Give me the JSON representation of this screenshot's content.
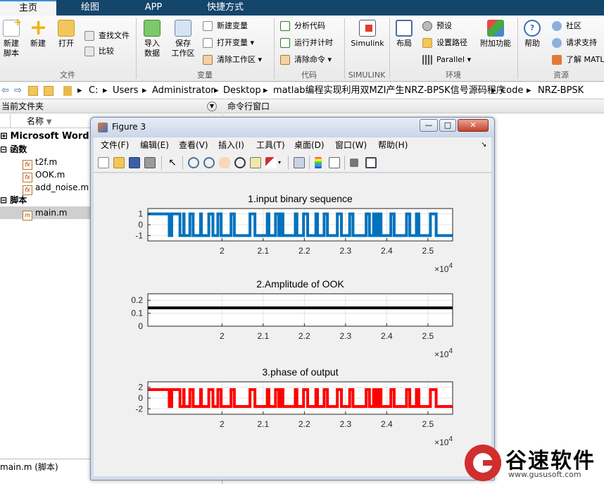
{
  "tabs": [
    "主页",
    "绘图",
    "APP",
    "快捷方式"
  ],
  "ribbon": {
    "big_buttons": [
      {
        "label": "新建\n脚本",
        "icon": "new-script-icon"
      },
      {
        "label": "新建",
        "icon": "new-icon"
      },
      {
        "label": "打开",
        "icon": "open-folder-icon"
      },
      {
        "label": "导入\n数据",
        "icon": "import-data-icon"
      },
      {
        "label": "保存\n工作区",
        "icon": "save-workspace-icon"
      },
      {
        "label": "Simulink",
        "icon": "simulink-icon"
      },
      {
        "label": "布局",
        "icon": "layout-icon"
      },
      {
        "label": "附加功能",
        "icon": "add-ons-icon"
      },
      {
        "label": "帮助",
        "icon": "help-icon"
      }
    ],
    "small_buttons": {
      "find_files": "查找文件",
      "compare": "比较",
      "new_variable": "新建变量",
      "open_variable": "打开变量",
      "clear_workspace": "清除工作区",
      "analyze_code": "分析代码",
      "run_and_time": "运行并计时",
      "clear_commands": "清除命令",
      "preferences": "预设",
      "set_path": "设置路径",
      "parallel": "Parallel",
      "community": "社区",
      "request_support": "请求支持",
      "learn_matlab": "了解 MATL"
    },
    "groups": [
      "文件",
      "变量",
      "代码",
      "SIMULINK",
      "环境",
      "资源"
    ]
  },
  "address": {
    "drive": "C:",
    "path": [
      "Users",
      "Administrator",
      "Desktop",
      "matlab编程实现利用双MZI产生NRZ-BPSK信号源码程序",
      "code",
      "NRZ-BPSK"
    ]
  },
  "current_folder": {
    "title": "当前文件夹",
    "column": "名称",
    "items": [
      {
        "label": "Microsoft Word 文",
        "kind": "group"
      },
      {
        "label": "函数",
        "kind": "group"
      },
      {
        "label": "t2f.m",
        "kind": "file"
      },
      {
        "label": "OOK.m",
        "kind": "file"
      },
      {
        "label": "add_noise.m",
        "kind": "file"
      },
      {
        "label": "脚本",
        "kind": "group"
      },
      {
        "label": "main.m",
        "kind": "file",
        "selected": true
      }
    ],
    "status": "main.m  (脚本)"
  },
  "command_window": {
    "title": "命令行窗口"
  },
  "figure": {
    "title": "Figure 3",
    "menu": [
      "文件(F)",
      "编辑(E)",
      "查看(V)",
      "插入(I)",
      "工具(T)",
      "桌面(D)",
      "窗口(W)",
      "帮助(H)"
    ],
    "window_controls": {
      "minimize": "—",
      "maximize": "□",
      "close": "✕"
    },
    "toolbar_icons": [
      "new-figure-icon",
      "open-icon",
      "save-icon",
      "print-icon",
      "pointer-icon",
      "zoom-in-icon",
      "zoom-out-icon",
      "pan-icon",
      "rotate-icon",
      "data-cursor-icon",
      "brush-icon",
      "link-icon",
      "colorbar-icon",
      "legend-icon",
      "hide-plot-tools-icon",
      "show-plot-tools-icon"
    ]
  },
  "watermark": {
    "text": "谷速软件",
    "url": "www.gususoft.com"
  },
  "chart_data": [
    {
      "type": "line",
      "title": "1.input binary sequence",
      "color": "#0072bd",
      "xlim": [
        1.82,
        2.56
      ],
      "ylim": [
        -1.5,
        1.5
      ],
      "xticks": [
        2,
        2.1,
        2.2,
        2.3,
        2.4,
        2.5
      ],
      "yticks": [
        -1,
        0,
        1
      ],
      "exponent_label": "×10^4",
      "levels": [
        -1,
        1
      ],
      "transitions": [
        1.82,
        1.872,
        1.878,
        1.898,
        1.907,
        1.908,
        1.922,
        1.93,
        1.948,
        1.95,
        1.968,
        1.978,
        1.99,
        1.998,
        2.022,
        2.03,
        2.068,
        2.08,
        2.11,
        2.114,
        2.13,
        2.138,
        2.142,
        2.148,
        2.178,
        2.182,
        2.198,
        2.208,
        2.228,
        2.232,
        2.248,
        2.256,
        2.28,
        2.29,
        2.31,
        2.318,
        2.35,
        2.358,
        2.368,
        2.374,
        2.38,
        2.386,
        2.41,
        2.418,
        2.448,
        2.456,
        2.472,
        2.478,
        2.506,
        2.52,
        2.56
      ],
      "start_level": 1
    },
    {
      "type": "line",
      "title": "2.Amplitude of OOK",
      "color": "#000000",
      "xlim": [
        1.82,
        2.56
      ],
      "ylim": [
        0,
        0.25
      ],
      "xticks": [
        2,
        2.1,
        2.2,
        2.3,
        2.4,
        2.5
      ],
      "yticks": [
        0,
        0.1,
        0.2
      ],
      "exponent_label": "×10^4",
      "constant": 0.141
    },
    {
      "type": "line",
      "title": "3.phase of output",
      "color": "#ff0000",
      "xlim": [
        1.82,
        2.56
      ],
      "ylim": [
        -3,
        3
      ],
      "xticks": [
        2,
        2.1,
        2.2,
        2.3,
        2.4,
        2.5
      ],
      "yticks": [
        -2,
        0,
        2
      ],
      "exponent_label": "×10^4",
      "levels": [
        -1.57,
        1.57
      ],
      "same_sequence_as": 0
    }
  ]
}
